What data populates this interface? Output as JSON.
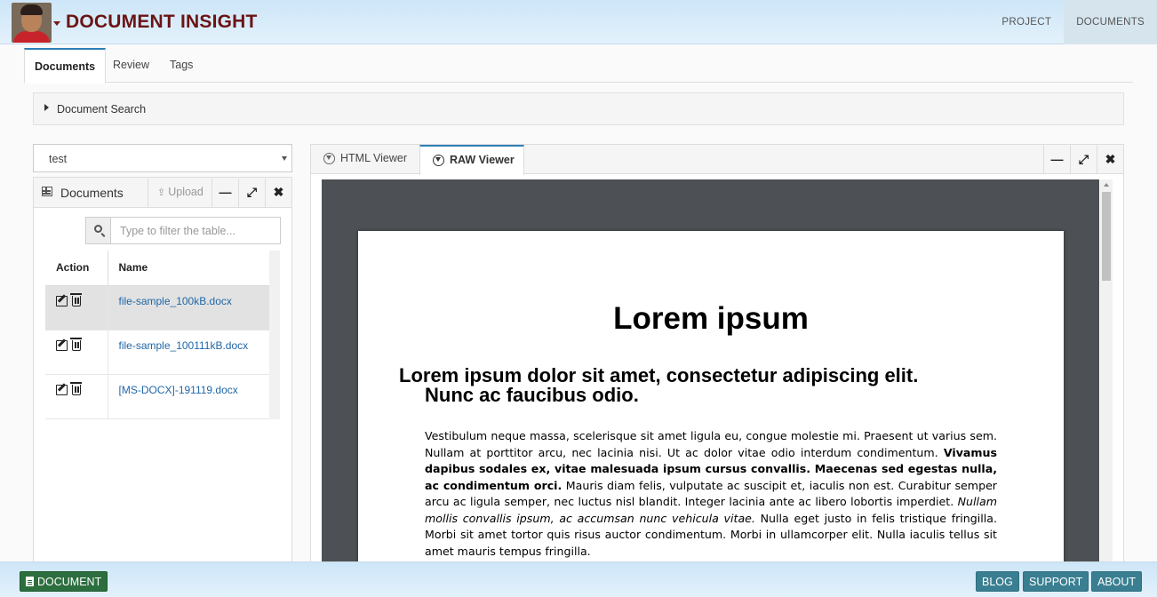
{
  "header": {
    "title": "DOCUMENT INSIGHT",
    "nav": [
      {
        "label": "PROJECT",
        "active": false
      },
      {
        "label": "DOCUMENTS",
        "active": true
      }
    ]
  },
  "subtabs": [
    {
      "label": "Documents",
      "active": true
    },
    {
      "label": "Review",
      "active": false
    },
    {
      "label": "Tags",
      "active": false
    }
  ],
  "document_search": {
    "label": "Document Search"
  },
  "project_select": {
    "value": "test"
  },
  "documents_panel": {
    "title": "Documents",
    "upload_label": "Upload",
    "filter_placeholder": "Type to filter the table...",
    "columns": [
      "Action",
      "Name"
    ],
    "rows": [
      {
        "name": "file-sample_100kB.docx",
        "selected": true
      },
      {
        "name": "file-sample_100111kB.docx",
        "selected": false
      },
      {
        "name": "[MS-DOCX]-191119.docx",
        "selected": false
      }
    ]
  },
  "viewer": {
    "tabs": [
      {
        "label": "HTML Viewer",
        "active": false
      },
      {
        "label": "RAW Viewer",
        "active": true
      }
    ],
    "document": {
      "title": "Lorem ipsum",
      "heading_line1": "Lorem ipsum dolor sit amet, consectetur adipiscing elit.",
      "heading_line2": "Nunc ac faucibus odio.",
      "para_text1": "Vestibulum neque massa, scelerisque sit amet ligula eu, congue molestie mi. Praesent ut varius sem. Nullam at porttitor arcu, nec lacinia nisi. Ut ac dolor vitae odio interdum condimentum. ",
      "para_bold": "Vivamus dapibus sodales ex, vitae malesuada ipsum cursus convallis. Maecenas sed egestas nulla, ac condimentum orci.",
      "para_text2": " Mauris diam felis, vulputate ac suscipit et, iaculis non est. Curabitur semper arcu ac ligula semper, nec luctus nisl blandit. Integer lacinia ante ac libero lobortis imperdiet. ",
      "para_italic": "Nullam mollis convallis ipsum, ac accumsan nunc vehicula vitae.",
      "para_text3": " Nulla eget justo in felis tristique fringilla. Morbi sit amet tortor quis risus auctor condimentum. Morbi in ullamcorper elit. Nulla iaculis tellus sit amet mauris tempus fringilla."
    }
  },
  "footer": {
    "document_label": "DOCUMENT",
    "links": [
      "BLOG",
      "SUPPORT",
      "ABOUT"
    ]
  },
  "colors": {
    "title": "#6b1414",
    "accent": "#2e7fb8",
    "footer_green": "#2d6e3e",
    "footer_teal": "#3a7f91"
  }
}
